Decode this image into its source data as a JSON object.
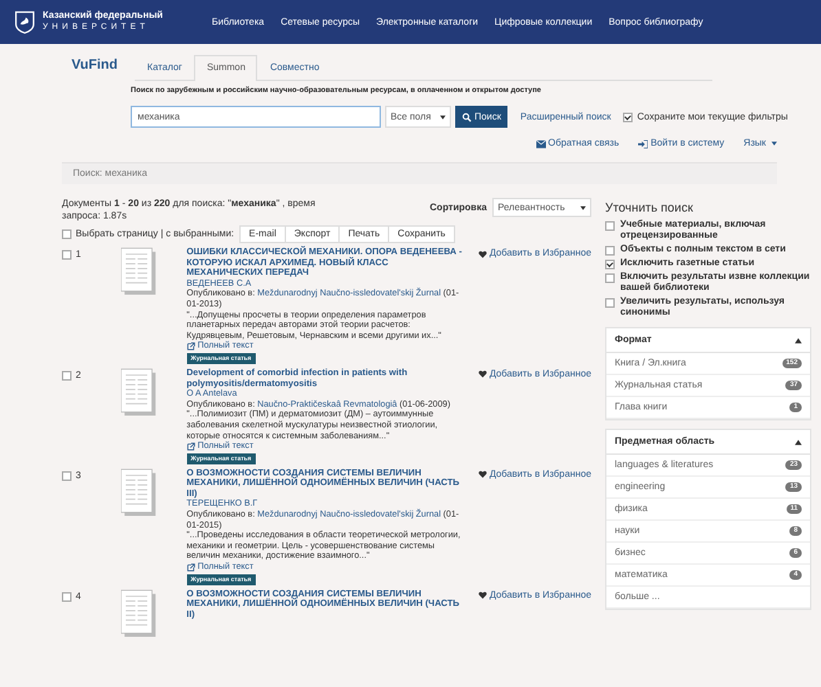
{
  "header": {
    "logo_line1": "Казанский федеральный",
    "logo_line2": "УНИВЕРСИТЕТ",
    "nav": [
      "Библиотека",
      "Сетевые ресурсы",
      "Электронные каталоги",
      "Цифровые коллекции",
      "Вопрос библиографу"
    ]
  },
  "app_name": "VuFind",
  "tabs": [
    {
      "label": "Каталог",
      "selected": false
    },
    {
      "label": "Summon",
      "selected": true
    },
    {
      "label": "Совместно",
      "selected": false
    }
  ],
  "subtitle": "Поиск по зарубежным и российским научно-образовательным ресурсам, в оплаченном и открытом доступе",
  "search": {
    "value": "механика",
    "field": "Все поля",
    "button": "Поиск",
    "advanced": "Расширенный поиск",
    "keep_filters": {
      "label": "Сохраните мои текущие фильтры",
      "checked": true
    }
  },
  "user_links": [
    {
      "kind": "feedback",
      "label": "Обратная связь"
    },
    {
      "kind": "login",
      "label": "Войти в систему"
    },
    {
      "kind": "language",
      "label": "Язык"
    }
  ],
  "breadcrumb": "Поиск: механика",
  "summary": "Документы **1** - **20** из **220** для поиска: \"**механика**\" , время запроса: 1.87s",
  "sort": {
    "label": "Сортировка",
    "value": "Релевантность"
  },
  "bulk": {
    "label": "Выбрать страницу | с выбранными:",
    "checked": false,
    "buttons": [
      "E-mail",
      "Экспорт",
      "Печать",
      "Сохранить"
    ]
  },
  "results": [
    {
      "number": "1",
      "checked": false,
      "title": "ОШИБКИ КЛАССИЧЕСКОЙ МЕХАНИКИ. ОПОРА ВЕДЕНЕЕВА - КОТОРУЮ ИСКАЛ АРХИМЕД. НОВЫЙ КЛАСС МЕХАНИЧЕСКИХ ПЕРЕДАЧ",
      "author": "ВЕДЕНЕЕВ С.А",
      "published_label": "Опубликовано в:",
      "source": "Meždunarodnyj Naučno-issledovatel'skij Žurnal",
      "date": "(01-01-2013)",
      "snippet": "\"...Допущены просчеты в теории определения параметров планетарных передач авторами этой теории расчетов: Кудрявцевым, Решетовым, Чернавским и всеми другими их...\"",
      "fulltext": "Полный текст",
      "format": "Журнальная статья",
      "favorite": "Добавить в Избранное"
    },
    {
      "number": "2",
      "checked": false,
      "title": "Development of comorbid infection in patients with polymyositis/dermatomyositis",
      "author": "O A Antelava",
      "published_label": "Опубликовано в:",
      "source": "Naučno-Praktičeskaâ Revmatologiâ",
      "date": "(01-06-2009)",
      "snippet": "\"...Полимиозит (ПМ) и дерматомиозит (ДМ) – аутоиммунные заболевания скелетной мускулатуры неизвестной этиологии, которые относятся к системным заболеваниям...\"",
      "fulltext": "Полный текст",
      "format": "Журнальная статья",
      "favorite": "Добавить в Избранное"
    },
    {
      "number": "3",
      "checked": false,
      "title": "О ВОЗМОЖНОСТИ СОЗДАНИЯ СИСТЕМЫ ВЕЛИЧИН МЕХАНИКИ, ЛИШЁННОЙ ОДНОИМЁННЫХ ВЕЛИЧИН (ЧАСТЬ III)",
      "author": "ТЕРЕЩЕНКО В.Г",
      "published_label": "Опубликовано в:",
      "source": "Meždunarodnyj Naučno-issledovatel'skij Žurnal",
      "date": "(01-01-2015)",
      "snippet": "\"...Проведены исследования в области теоретической метрологии, механики и геометрии. Цель - усовершенствование системы величин механики, достижение взаимного...\"",
      "fulltext": "Полный текст",
      "format": "Журнальная статья",
      "favorite": "Добавить в Избранное"
    },
    {
      "number": "4",
      "checked": false,
      "title": "О ВОЗМОЖНОСТИ СОЗДАНИЯ СИСТЕМЫ ВЕЛИЧИН МЕХАНИКИ, ЛИШЁННОЙ ОДНОИМЁННЫХ ВЕЛИЧИН (ЧАСТЬ II)",
      "favorite": "Добавить в Избранное"
    }
  ],
  "sidebar": {
    "title": "Уточнить поиск",
    "filters": [
      {
        "label": "Учебные материалы, включая отрецензированные",
        "checked": false
      },
      {
        "label": "Объекты с полным текстом в сети",
        "checked": false
      },
      {
        "label": "Исключить газетные статьи",
        "checked": true
      },
      {
        "label": "Включить результаты извне коллекции вашей библиотеки",
        "checked": false
      },
      {
        "label": "Увеличить результаты, используя синонимы",
        "checked": false
      }
    ],
    "facets": [
      {
        "title": "Формат",
        "expanded": true,
        "items": [
          {
            "label": "Книга / Эл.книга",
            "count": "152"
          },
          {
            "label": "Журнальная статья",
            "count": "37"
          },
          {
            "label": "Глава книги",
            "count": "1"
          }
        ]
      },
      {
        "title": "Предметная область",
        "expanded": true,
        "items": [
          {
            "label": "languages & literatures",
            "count": "23"
          },
          {
            "label": "engineering",
            "count": "13"
          },
          {
            "label": "физика",
            "count": "11"
          },
          {
            "label": "науки",
            "count": "8"
          },
          {
            "label": "бизнес",
            "count": "6"
          },
          {
            "label": "математика",
            "count": "4"
          },
          {
            "label": "больше ..."
          }
        ]
      }
    ]
  }
}
